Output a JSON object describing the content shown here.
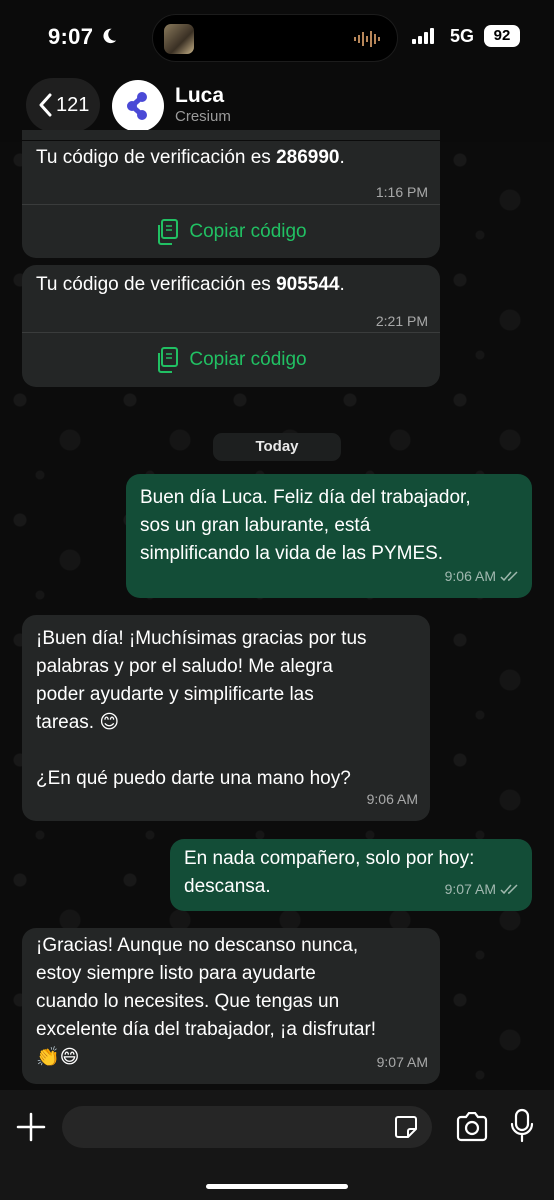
{
  "status": {
    "time": "9:07",
    "network": "5G",
    "battery": "92"
  },
  "header": {
    "back_count": "121",
    "contact_name": "Luca",
    "contact_subtitle": "Cresium"
  },
  "messages": [
    {
      "direction": "in",
      "prefix": "Tu código de verificación es ",
      "code": "286990",
      "suffix": ".",
      "time": "1:16 PM",
      "action": "Copiar código"
    },
    {
      "direction": "in",
      "prefix": "Tu código de verificación es ",
      "code": "905544",
      "suffix": ".",
      "time": "2:21 PM",
      "action": "Copiar código"
    },
    {
      "direction": "out",
      "text": "Buen día Luca. Feliz día del trabajador,\nsos un gran laburante, está\nsimplificando la vida de las PYMES.",
      "time": "9:06 AM"
    },
    {
      "direction": "in",
      "text": "¡Buen día! ¡Muchísimas gracias por tus\npalabras y por el saludo! Me alegra\npoder ayudarte y simplificarte las\ntareas. 😊\n\n¿En qué puedo darte una mano hoy?",
      "time": "9:06 AM"
    },
    {
      "direction": "out",
      "text": "En nada compañero, solo por hoy:\ndescansa.",
      "time": "9:07 AM"
    },
    {
      "direction": "in",
      "text": "¡Gracias! Aunque no descanso nunca,\nestoy siempre listo para ayudarte\ncuando lo necesites. Que tengas un\nexcelente día del trabajador, ¡a disfrutar!\n👏😄",
      "time": "9:07 AM"
    }
  ],
  "date_separator": "Today",
  "composer": {
    "value": "",
    "placeholder": ""
  },
  "colors": {
    "incoming_bubble": "#242626",
    "outgoing_bubble": "#134d37",
    "accent_green": "#21c063",
    "read_ticks": "#9fb8ad"
  }
}
